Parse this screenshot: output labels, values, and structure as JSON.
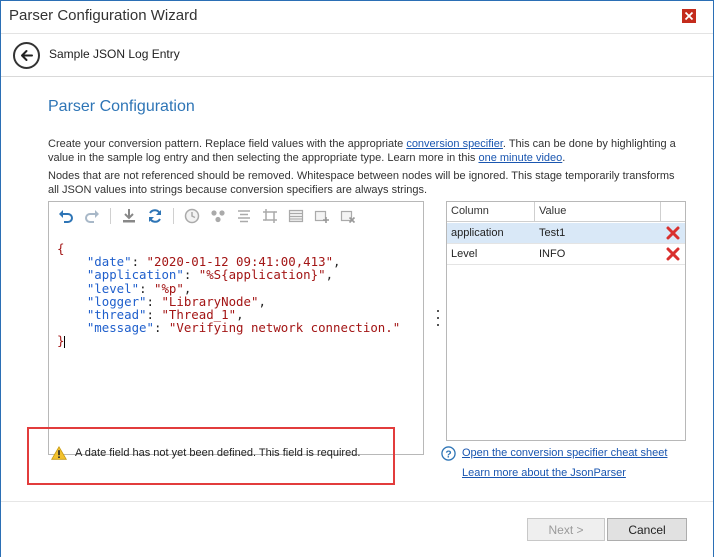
{
  "window": {
    "title": "Parser Configuration Wizard",
    "close_icon": "close-icon",
    "accent": "#2b6fb5",
    "close_color": "#c42b1c"
  },
  "subheader": {
    "back_icon": "back-arrow-icon",
    "label": "Sample JSON Log Entry"
  },
  "section": {
    "title": "Parser Configuration",
    "title_color": "#2e75b6"
  },
  "description": {
    "p1_part1": "Create your conversion pattern.  Replace field values with the appropriate ",
    "p1_link": "conversion specifier",
    "p1_part2": ".  This can be done by highlighting a value in the sample log entry and then selecting the appropriate type.  Learn more in this ",
    "p1_link2": "one minute video",
    "p1_part3": ".",
    "p2": "Nodes that are not referenced should be removed.  Whitespace between nodes will be ignored.  This stage temporarily transforms all JSON values into strings because conversion specifiers are always strings."
  },
  "toolbar": {
    "buttons": [
      {
        "name": "undo-icon"
      },
      {
        "name": "redo-icon"
      },
      {
        "name": "download-icon"
      },
      {
        "name": "refresh-icon"
      },
      {
        "name": "clock-icon"
      },
      {
        "name": "dots-icon"
      },
      {
        "name": "align-icon"
      },
      {
        "name": "transform-icon"
      },
      {
        "name": "table-icon"
      },
      {
        "name": "add-row-icon"
      },
      {
        "name": "delete-row-icon"
      }
    ]
  },
  "code": {
    "open_brace": "{",
    "close_brace": "}",
    "lines": [
      {
        "key": "\"date\"",
        "value": "\"2020-01-12 09:41:00,413\""
      },
      {
        "key": "\"application\"",
        "value": "\"%S{application}\""
      },
      {
        "key": "\"level\"",
        "value": "\"%p\""
      },
      {
        "key": "\"logger\"",
        "value": "\"LibraryNode\""
      },
      {
        "key": "\"thread\"",
        "value": "\"Thread_1\""
      },
      {
        "key": "\"message\"",
        "value": "\"Verifying network connection.\""
      }
    ],
    "key_color": "#1f5fcc",
    "value_color": "#a31515"
  },
  "grid": {
    "columns": [
      "Column",
      "Value"
    ],
    "rows": [
      {
        "column": "application",
        "value": "Test1",
        "selected": true
      },
      {
        "column": "Level",
        "value": "INFO",
        "selected": false
      }
    ],
    "delete_icon": "delete-x-icon",
    "delete_color": "#d9302e",
    "selected_color": "#d9e8f7"
  },
  "warning": {
    "icon": "warning-icon",
    "text": "A date field has not yet been defined.  This field is required.",
    "highlight_color": "#e23c3c"
  },
  "links": {
    "help_icon": "help-icon",
    "cheat_sheet": "Open the conversion specifier cheat sheet",
    "json_parser": "Learn more about the JsonParser"
  },
  "footer": {
    "next_label": "Next >",
    "cancel_label": "Cancel"
  }
}
